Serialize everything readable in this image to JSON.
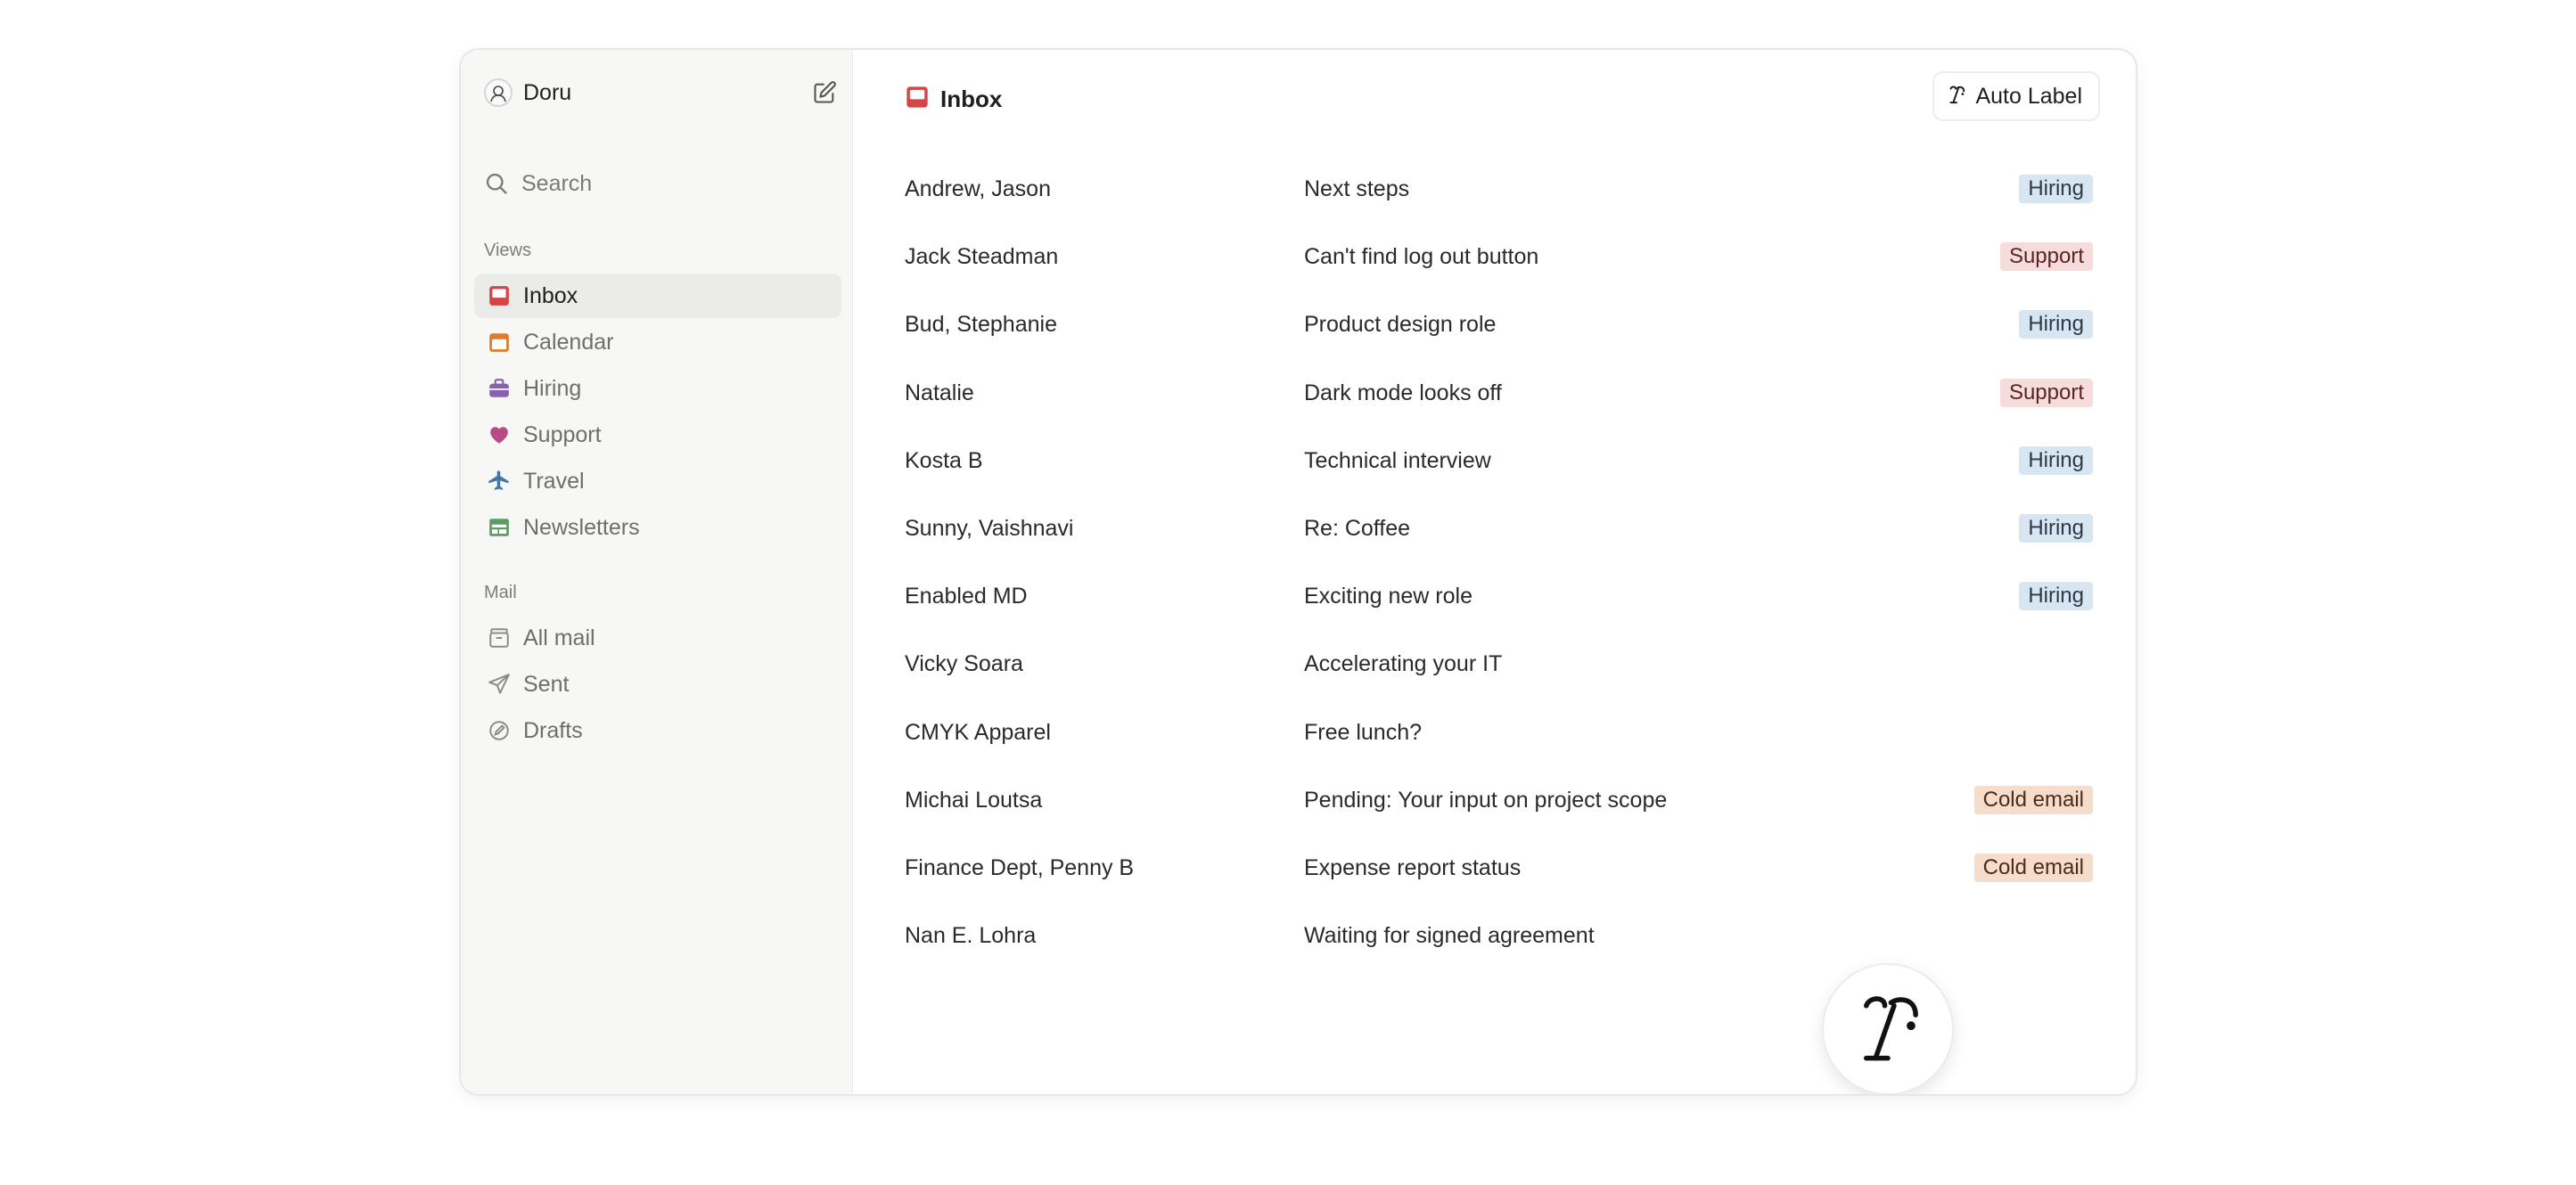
{
  "user": {
    "name": "Doru"
  },
  "search": {
    "label": "Search"
  },
  "sidebar": {
    "views_label": "Views",
    "views": [
      {
        "label": "Inbox",
        "icon": "inbox-icon",
        "color": "#d64545",
        "active": true
      },
      {
        "label": "Calendar",
        "icon": "calendar-icon",
        "color": "#e07a2e",
        "active": false
      },
      {
        "label": "Hiring",
        "icon": "briefcase-icon",
        "color": "#8a5fb0",
        "active": false
      },
      {
        "label": "Support",
        "icon": "heart-icon",
        "color": "#b84a84",
        "active": false
      },
      {
        "label": "Travel",
        "icon": "airplane-icon",
        "color": "#3f78a8",
        "active": false
      },
      {
        "label": "Newsletters",
        "icon": "newspaper-icon",
        "color": "#5d9b62",
        "active": false
      }
    ],
    "mail_label": "Mail",
    "mail": [
      {
        "label": "All mail",
        "icon": "archive-icon"
      },
      {
        "label": "Sent",
        "icon": "send-icon"
      },
      {
        "label": "Drafts",
        "icon": "draft-icon"
      }
    ]
  },
  "main": {
    "title": "Inbox",
    "auto_label_button": "Auto Label"
  },
  "emails": [
    {
      "sender": "Andrew, Jason",
      "subject": "Next steps",
      "tag": "Hiring"
    },
    {
      "sender": "Jack Steadman",
      "subject": "Can't find log out button",
      "tag": "Support"
    },
    {
      "sender": "Bud, Stephanie",
      "subject": "Product design role",
      "tag": "Hiring"
    },
    {
      "sender": "Natalie",
      "subject": "Dark mode looks off",
      "tag": "Support"
    },
    {
      "sender": "Kosta B",
      "subject": "Technical interview",
      "tag": "Hiring"
    },
    {
      "sender": "Sunny, Vaishnavi",
      "subject": "Re: Coffee",
      "tag": "Hiring"
    },
    {
      "sender": "Enabled MD",
      "subject": "Exciting new role",
      "tag": "Hiring"
    },
    {
      "sender": "Vicky Soara",
      "subject": "Accelerating your IT",
      "tag": ""
    },
    {
      "sender": "CMYK Apparel",
      "subject": "Free lunch?",
      "tag": ""
    },
    {
      "sender": "Michai Loutsa",
      "subject": "Pending: Your input on project scope",
      "tag": "Cold email"
    },
    {
      "sender": "Finance Dept, Penny B",
      "subject": "Expense report status",
      "tag": "Cold email"
    },
    {
      "sender": "Nan E. Lohra",
      "subject": "Waiting for signed agreement",
      "tag": ""
    }
  ],
  "tag_colors": {
    "Hiring": {
      "bg": "#d8e6f2",
      "fg": "#2a3a4a"
    },
    "Support": {
      "bg": "#f7dcdc",
      "fg": "#5a2424"
    },
    "Cold email": {
      "bg": "#f6dccb",
      "fg": "#4a2c1c"
    }
  }
}
